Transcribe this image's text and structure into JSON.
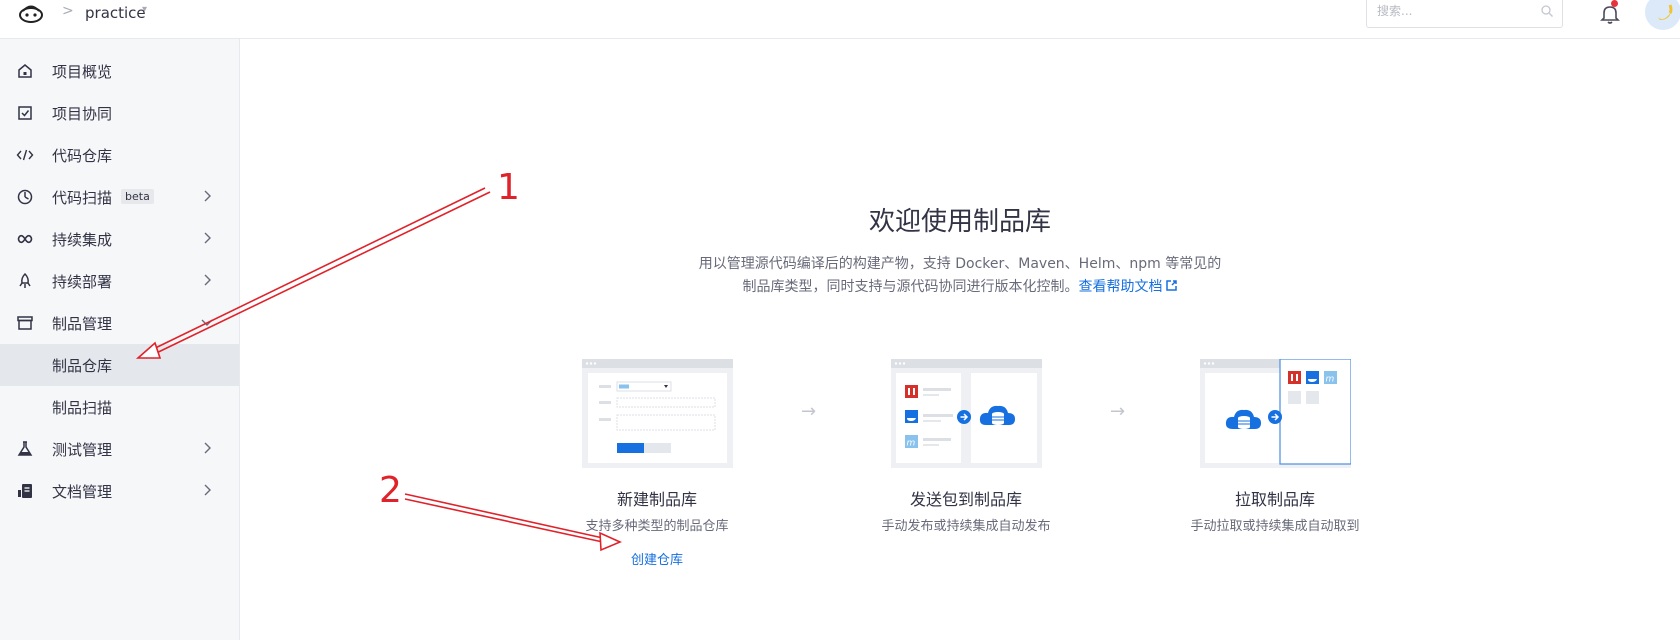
{
  "header": {
    "separator": ">",
    "project_name": "practice",
    "project_caret": "▾",
    "search_placeholder": "搜索..."
  },
  "sidebar": {
    "items": [
      {
        "label": "项目概览",
        "icon": "home-icon"
      },
      {
        "label": "项目协同",
        "icon": "check-square-icon"
      },
      {
        "label": "代码仓库",
        "icon": "code-icon"
      },
      {
        "label": "代码扫描",
        "icon": "scan-icon",
        "badge": "beta",
        "expandable": true
      },
      {
        "label": "持续集成",
        "icon": "infinity-icon",
        "expandable": true
      },
      {
        "label": "持续部署",
        "icon": "rocket-icon",
        "expandable": true
      },
      {
        "label": "制品管理",
        "icon": "box-icon",
        "expandable": true,
        "expanded": true
      },
      {
        "label": "制品仓库",
        "sub": true,
        "active": true
      },
      {
        "label": "制品扫描",
        "sub": true
      },
      {
        "label": "测试管理",
        "icon": "flask-icon",
        "expandable": true
      },
      {
        "label": "文档管理",
        "icon": "doc-icon",
        "expandable": true
      }
    ]
  },
  "main": {
    "title": "欢迎使用制品库",
    "desc_line1": "用以管理源代码编译后的构建产物，支持 Docker、Maven、Helm、npm 等常见的",
    "desc_line2": "制品库类型，同时支持与源代码协同进行版本化控制。",
    "help_link": "查看帮助文档",
    "flow_arrow": "→",
    "steps": [
      {
        "title": "新建制品库",
        "desc": "支持多种类型的制品仓库",
        "link": "创建仓库"
      },
      {
        "title": "发送包到制品库",
        "desc": "手动发布或持续集成自动发布"
      },
      {
        "title": "拉取制品库",
        "desc": "手动拉取或持续集成自动取到"
      }
    ]
  },
  "annotations": {
    "label_1": "1",
    "label_2": "2",
    "color": "#e0222a"
  },
  "colors": {
    "accent": "#1670e0",
    "sidebar_bg": "#f6f7f9",
    "active_bg": "#e4e7ec"
  }
}
